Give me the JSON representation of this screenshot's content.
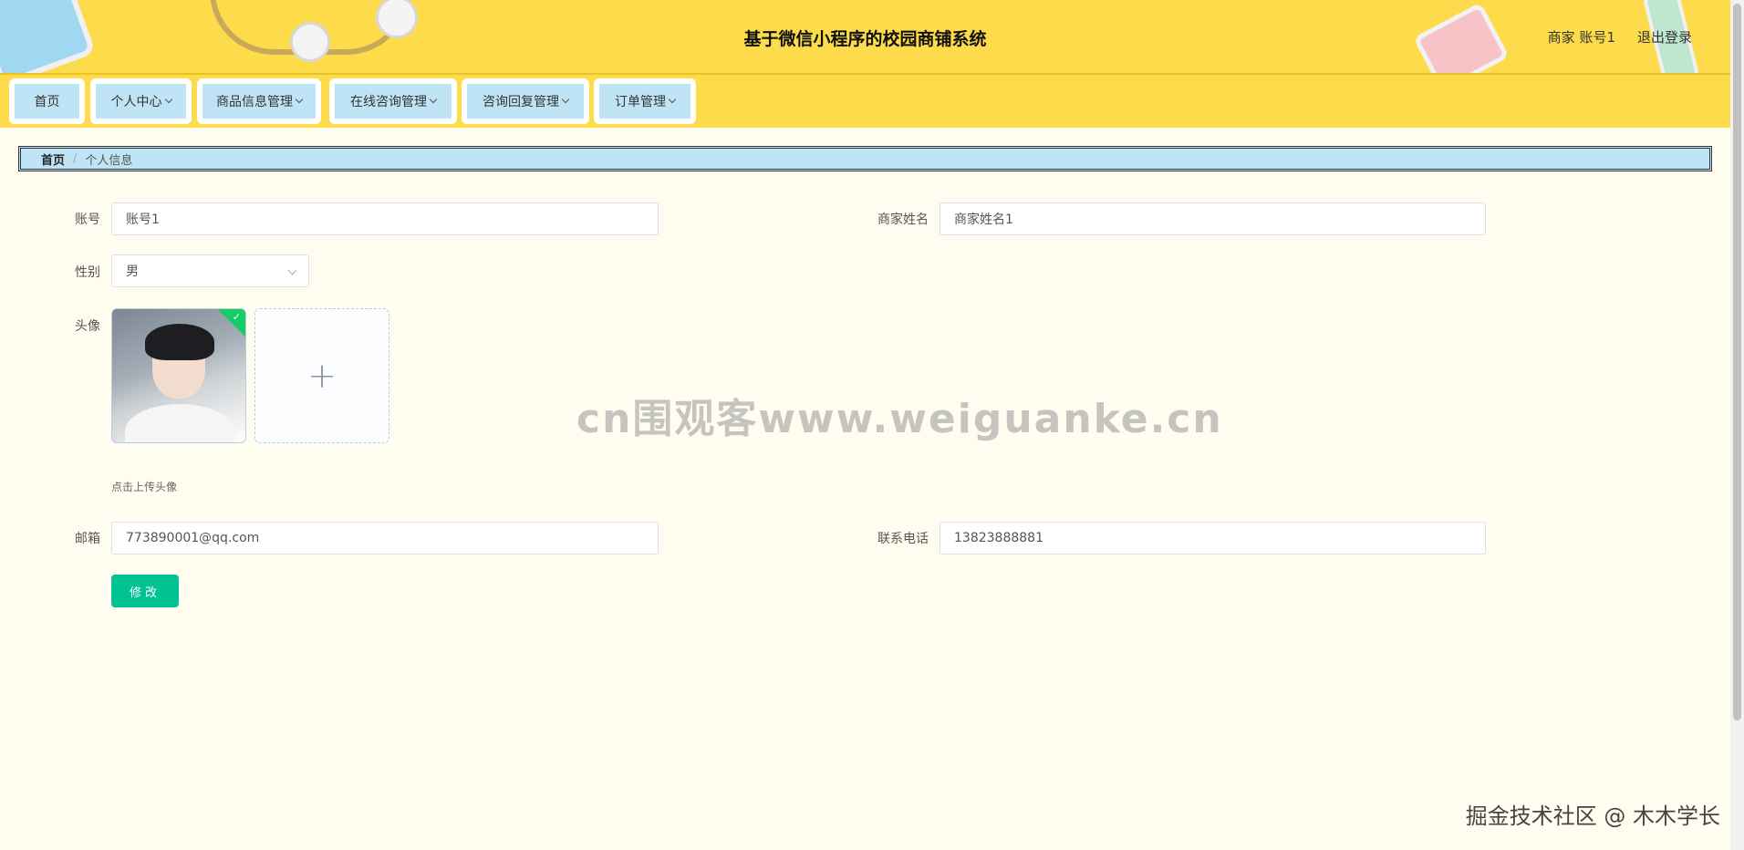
{
  "header": {
    "title": "基于微信小程序的校园商铺系统",
    "user_label": "商家 账号1",
    "logout_label": "退出登录"
  },
  "nav": {
    "items": [
      {
        "label": "首页",
        "has_dropdown": false
      },
      {
        "label": "个人中心",
        "has_dropdown": true
      },
      {
        "label": "商品信息管理",
        "has_dropdown": true
      },
      {
        "label": "在线咨询管理",
        "has_dropdown": true
      },
      {
        "label": "咨询回复管理",
        "has_dropdown": true
      },
      {
        "label": "订单管理",
        "has_dropdown": true
      }
    ]
  },
  "breadcrumb": {
    "home": "首页",
    "separator": "/",
    "current": "个人信息"
  },
  "form": {
    "account_label": "账号",
    "account_value": "账号1",
    "merchant_name_label": "商家姓名",
    "merchant_name_value": "商家姓名1",
    "gender_label": "性别",
    "gender_value": "男",
    "avatar_label": "头像",
    "avatar_tip": "点击上传头像",
    "email_label": "邮箱",
    "email_value": "773890001@qq.com",
    "phone_label": "联系电话",
    "phone_value": "13823888881",
    "submit_label": "修改"
  },
  "watermark": "cn围观客www.weiguanke.cn",
  "footer_mark": "掘金技术社区 @ 木木学长",
  "colors": {
    "header_bg": "#fddb4a",
    "nav_item_bg": "#bfe4f5",
    "page_bg": "#fefdf0",
    "submit_bg": "#00c292",
    "success_badge": "#13ce66"
  }
}
